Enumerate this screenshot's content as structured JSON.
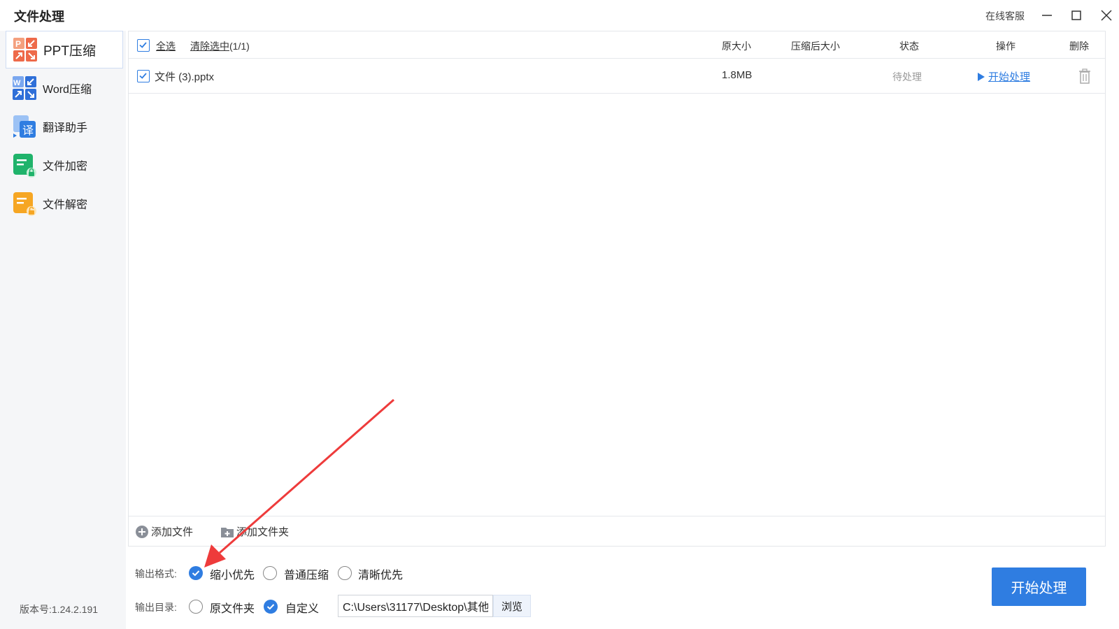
{
  "window": {
    "title": "文件处理",
    "service_label": "在线客服"
  },
  "sidebar": {
    "items": [
      {
        "label": "PPT压缩",
        "icon": "ppt-compress-icon",
        "active": true
      },
      {
        "label": "Word压缩",
        "icon": "word-compress-icon",
        "active": false
      },
      {
        "label": "翻译助手",
        "icon": "translate-icon",
        "active": false
      },
      {
        "label": "文件加密",
        "icon": "file-encrypt-icon",
        "active": false
      },
      {
        "label": "文件解密",
        "icon": "file-decrypt-icon",
        "active": false
      }
    ],
    "version": "版本号:1.24.2.191"
  },
  "table": {
    "select_all_label": "全选",
    "clear_selection_label": "清除选中",
    "selection_count": "(1/1)",
    "headers": {
      "original_size": "原大小",
      "compressed_size": "压缩后大小",
      "status": "状态",
      "action": "操作",
      "delete": "删除"
    },
    "rows": [
      {
        "checked": true,
        "filename": "文件 (3).pptx",
        "original_size": "1.8MB",
        "compressed_size": "",
        "status": "待处理",
        "action": "开始处理"
      }
    ]
  },
  "footer_bar": {
    "add_file": "添加文件",
    "add_folder": "添加文件夹"
  },
  "options": {
    "format_label": "输出格式:",
    "format_options": [
      {
        "label": "缩小优先",
        "selected": true
      },
      {
        "label": "普通压缩",
        "selected": false
      },
      {
        "label": "清晰优先",
        "selected": false
      }
    ],
    "dir_label": "输出目录:",
    "dir_options": [
      {
        "label": "原文件夹",
        "selected": false
      },
      {
        "label": "自定义",
        "selected": true
      }
    ],
    "path_value": "C:\\Users\\31177\\Desktop\\其他",
    "browse_label": "浏览"
  },
  "start_button": "开始处理",
  "colors": {
    "accent": "#2f7de1",
    "annotation_arrow": "#ee3b3b",
    "sidebar_bg": "#f5f6f8"
  }
}
